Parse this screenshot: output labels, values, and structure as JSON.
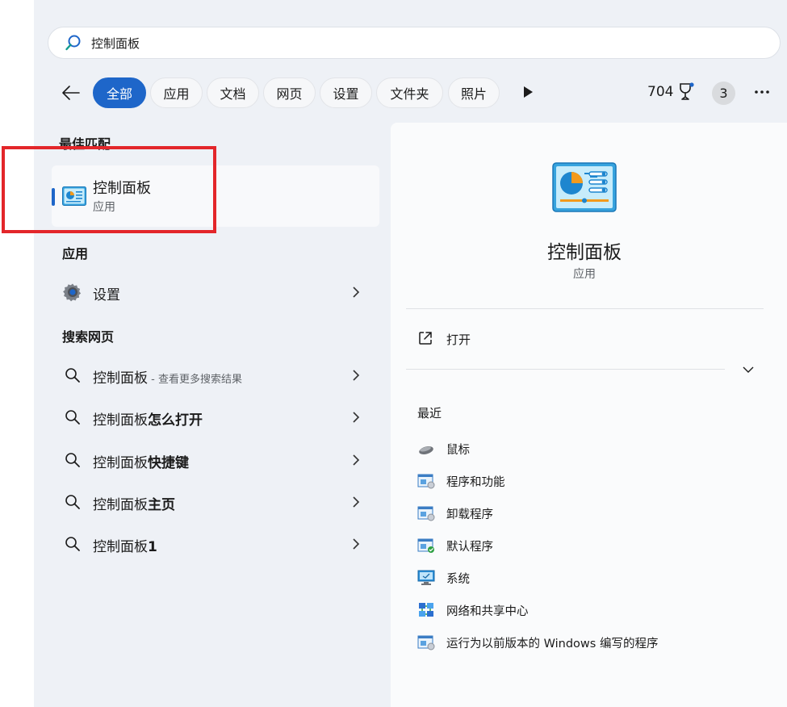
{
  "search": {
    "value": "控制面板"
  },
  "filters": [
    {
      "label": "全部",
      "active": true
    },
    {
      "label": "应用",
      "active": false
    },
    {
      "label": "文档",
      "active": false
    },
    {
      "label": "网页",
      "active": false
    },
    {
      "label": "设置",
      "active": false
    },
    {
      "label": "文件夹",
      "active": false
    },
    {
      "label": "照片",
      "active": false
    }
  ],
  "header_right": {
    "points": "704",
    "badge_count": "3"
  },
  "best_match": {
    "heading": "最佳匹配",
    "title": "控制面板",
    "subtitle": "应用"
  },
  "apps": {
    "heading": "应用",
    "items": [
      {
        "label": "设置",
        "icon": "gear-icon"
      }
    ]
  },
  "web": {
    "heading": "搜索网页",
    "items": [
      {
        "prefix": "控制面板",
        "suffix": "",
        "sub": " - 查看更多搜索结果"
      },
      {
        "prefix": "控制面板",
        "suffix": "怎么打开",
        "sub": ""
      },
      {
        "prefix": "控制面板",
        "suffix": "快捷键",
        "sub": ""
      },
      {
        "prefix": "控制面板",
        "suffix": "主页",
        "sub": ""
      },
      {
        "prefix": "控制面板",
        "suffix": "1",
        "sub": ""
      }
    ]
  },
  "detail": {
    "title": "控制面板",
    "subtitle": "应用",
    "open_label": "打开",
    "recent_heading": "最近",
    "recent": [
      {
        "label": "鼠标",
        "icon": "mouse-icon"
      },
      {
        "label": "程序和功能",
        "icon": "programs-icon"
      },
      {
        "label": "卸载程序",
        "icon": "uninstall-icon"
      },
      {
        "label": "默认程序",
        "icon": "default-programs-icon"
      },
      {
        "label": "系统",
        "icon": "system-icon"
      },
      {
        "label": "网络和共享中心",
        "icon": "network-icon"
      },
      {
        "label": "运行为以前版本的 Windows 编写的程序",
        "icon": "compatibility-icon"
      }
    ]
  },
  "colors": {
    "accent": "#1e66c9",
    "highlight_box": "#e3262a"
  }
}
